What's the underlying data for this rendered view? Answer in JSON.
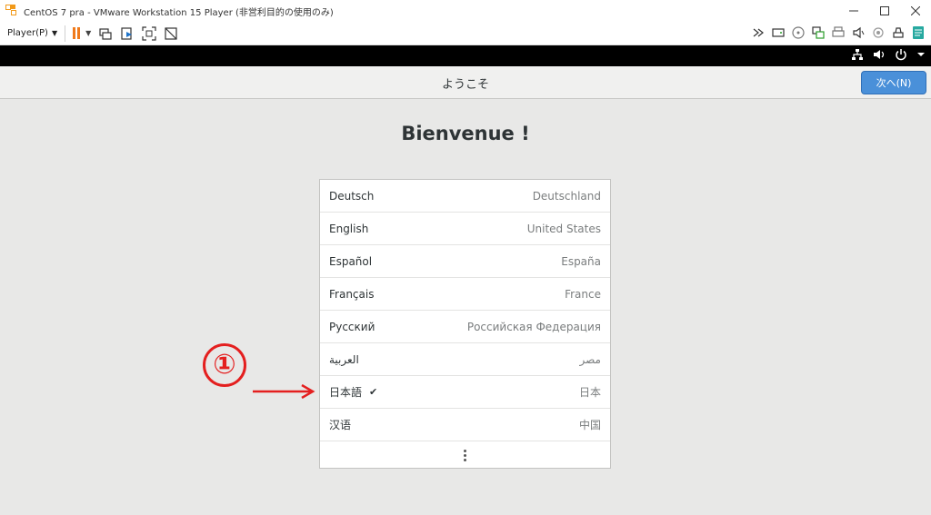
{
  "window": {
    "title": "CentOS 7 pra - VMware Workstation 15 Player (非営利目的の使用のみ)"
  },
  "toolbar": {
    "player_label": "Player(P)"
  },
  "header": {
    "title": "ようこそ",
    "next_label": "次へ(N)"
  },
  "main": {
    "welcome": "Bienvenue !",
    "languages": [
      {
        "name": "Deutsch",
        "region": "Deutschland",
        "selected": false
      },
      {
        "name": "English",
        "region": "United States",
        "selected": false
      },
      {
        "name": "Español",
        "region": "España",
        "selected": false
      },
      {
        "name": "Français",
        "region": "France",
        "selected": false
      },
      {
        "name": "Русский",
        "region": "Российская Федерация",
        "selected": false
      },
      {
        "name": "العربية",
        "region": "مصر",
        "selected": false
      },
      {
        "name": "日本語",
        "region": "日本",
        "selected": true
      },
      {
        "name": "汉语",
        "region": "中国",
        "selected": false
      }
    ],
    "check_mark": "✔"
  },
  "annotation": {
    "number": "①",
    "color": "#e41f1f"
  },
  "colors": {
    "accent": "#4a90d9",
    "pause": "#f07a1b",
    "vmware_logo": "#f29a1a"
  }
}
